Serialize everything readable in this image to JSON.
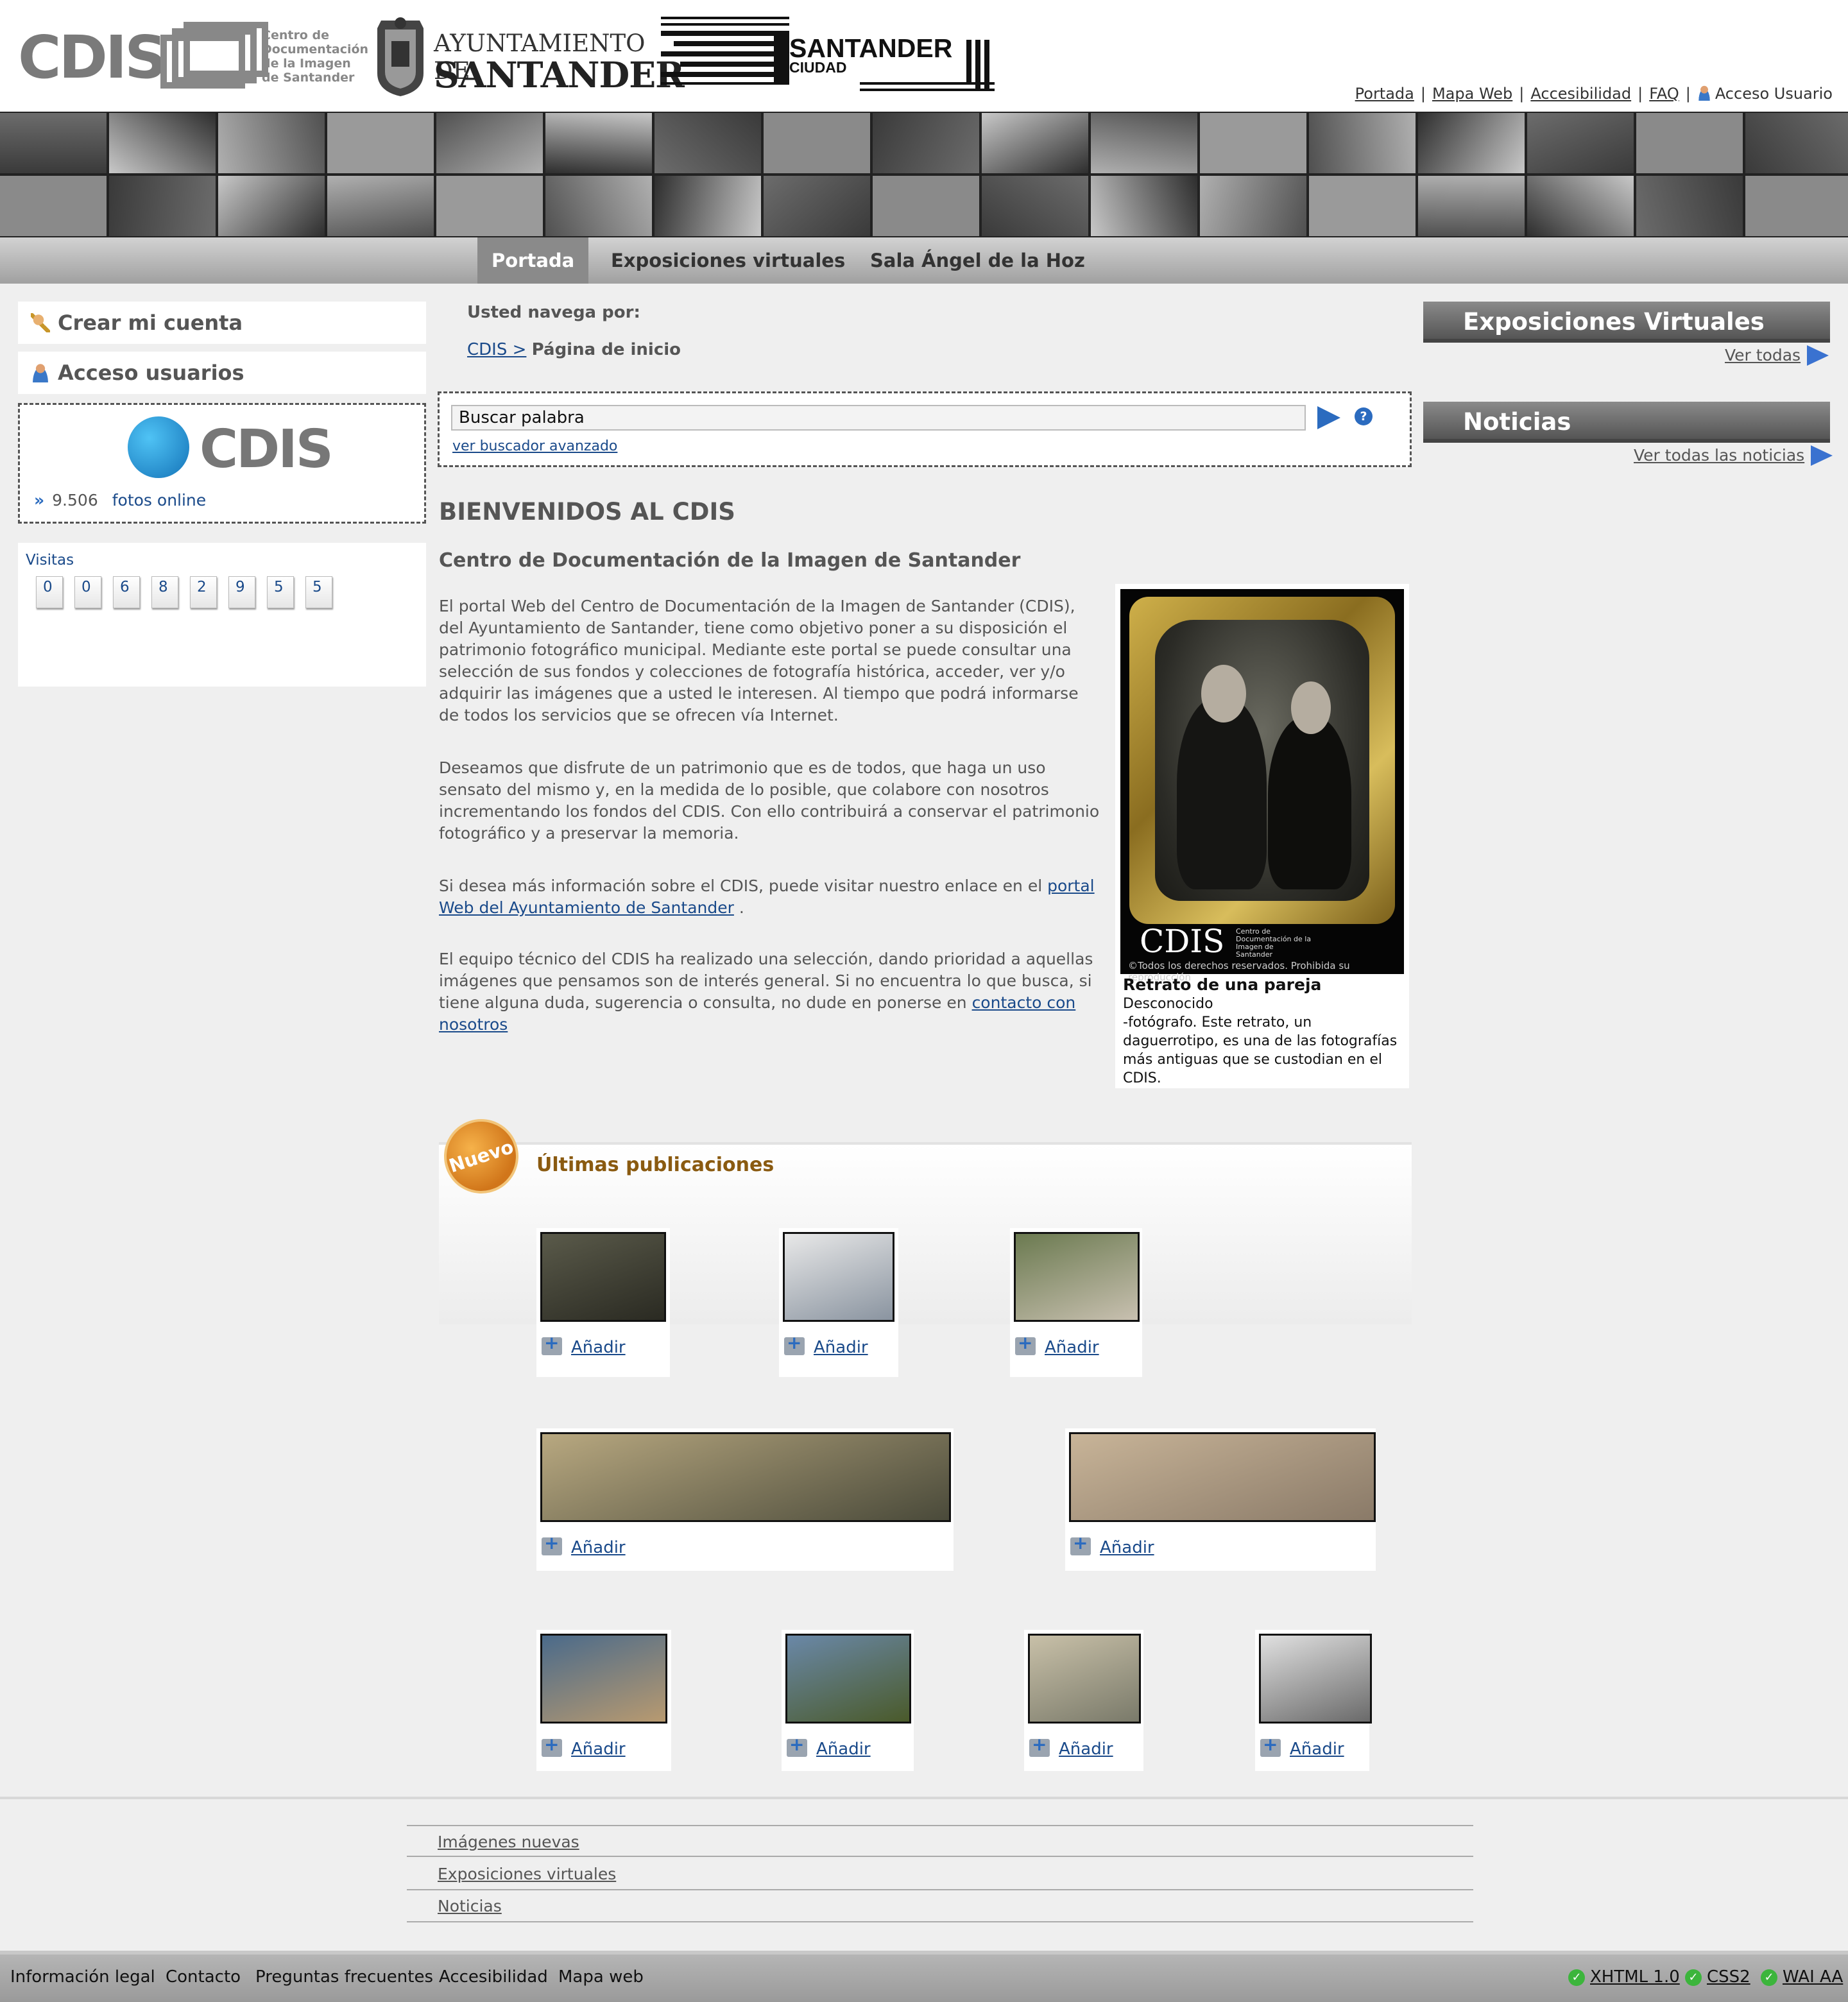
{
  "header": {
    "cdis_logo": "CDIS",
    "cdis_subtitle": "Centro de\nDocumentación\nde la Imagen\nde Santander",
    "ayto_line1": "AYUNTAMIENTO DE",
    "ayto_line2": "SANTANDER",
    "santander_line1": "SANTANDER",
    "santander_line2": "CIUDAD",
    "top_links": [
      "Portada",
      "Mapa Web",
      "Accesibilidad",
      "FAQ",
      "Acceso Usuario"
    ]
  },
  "nav": {
    "items": [
      "Portada",
      "Exposiciones virtuales",
      "Sala Ángel de la Hoz"
    ],
    "active": "Portada"
  },
  "left": {
    "create_account": "Crear mi cuenta",
    "user_access": "Acceso usuarios",
    "cdis_logo": "CDIS",
    "photo_count": "9.506",
    "photo_count_label": "fotos online",
    "visits_label": "Visitas",
    "visits_digits": [
      "0",
      "0",
      "6",
      "8",
      "2",
      "9",
      "5",
      "5"
    ]
  },
  "center": {
    "breadcrumb_heading": "Usted navega por:",
    "breadcrumb_link": "CDIS >",
    "breadcrumb_current": "Página de inicio",
    "search_value": "Buscar palabra",
    "search_help": "?",
    "advanced_search": "ver buscador avanzado",
    "title": "BIENVENIDOS AL CDIS",
    "subtitle": "Centro de Documentación de la Imagen de Santander",
    "para1": "El portal Web del Centro de Documentación de la Imagen de Santander (CDIS), del Ayuntamiento de Santander, tiene como objetivo poner a su disposición el patrimonio fotográfico municipal. Mediante este portal se puede consultar una selección de sus fondos y colecciones de fotografía histórica, acceder, ver y/o adquirir las imágenes que a usted le interesen. Al tiempo que podrá informarse de todos los servicios que se ofrecen vía Internet.",
    "para2": "Deseamos que disfrute de un patrimonio que es de todos, que haga un uso sensato del mismo y, en la medida de lo posible, que colabore con nosotros incrementando los fondos del CDIS. Con ello contribuirá a conservar el patrimonio fotográfico y a preservar la memoria.",
    "para3_text": "Si desea más información sobre el CDIS, puede visitar nuestro enlace en el",
    "para3_link": "portal Web del Ayuntamiento de Santander",
    "para3_end": ".",
    "para4_text": "El equipo técnico del CDIS ha realizado una selección, dando prioridad a aquellas imágenes que pensamos son de interés general. Si no encuentra lo que busca, si tiene alguna duda, sugerencia o consulta, no dude en ponerse en",
    "para4_link": "contacto con nosotros"
  },
  "feature": {
    "photo_logo": "CDIS",
    "photo_logo_sub": "Centro de\nDocumentación de la\nImagen de\nSantander",
    "photo_copyright": "©Todos los derechos reservados. Prohibida su reproducción",
    "caption_title": "Retrato de una pareja",
    "caption_desc": "Desconocido\n-fotógrafo. Este retrato, un daguerrotipo, es una de las fotografías más antiguas que se custodian en el CDIS."
  },
  "publications": {
    "badge": "Nuevo",
    "title": "Últimas publicaciones",
    "add_label": "Añadir"
  },
  "right": {
    "expo_title": "Exposiciones Virtuales",
    "expo_link": "Ver todas",
    "news_title": "Noticias",
    "news_link": "Ver todas las noticias"
  },
  "footer": {
    "links": [
      "Imágenes nuevas",
      "Exposiciones virtuales",
      "Noticias"
    ],
    "bottom_links": [
      "Información legal",
      "Contacto",
      "Preguntas frecuentes",
      "Accesibilidad",
      "Mapa web"
    ],
    "validators": [
      "XHTML 1.0",
      "CSS2",
      "WAI AA"
    ]
  },
  "colors": {
    "link": "#1a4a8a",
    "accent_blue": "#2b6bbf",
    "nav_active": "#8a8a8a",
    "badge_orange": "#d1761a"
  }
}
